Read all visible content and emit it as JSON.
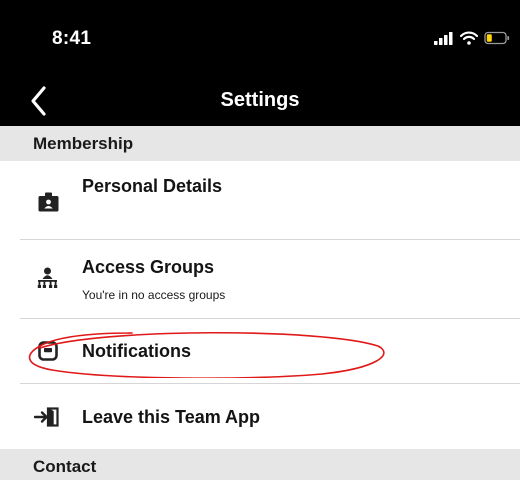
{
  "status_bar": {
    "time": "8:41",
    "icons": [
      "cellular-signal-icon",
      "wifi-icon",
      "battery-icon"
    ]
  },
  "header": {
    "title": "Settings",
    "back_icon": "chevron-left-icon"
  },
  "sections": {
    "membership": "Membership",
    "contact": "Contact"
  },
  "rows": {
    "personal_details": {
      "title": "Personal Details",
      "icon": "id-badge-icon"
    },
    "access_groups": {
      "title": "Access Groups",
      "subtitle": "You're in no access groups",
      "icon": "hierarchy-icon"
    },
    "notifications": {
      "title": "Notifications",
      "icon": "message-icon"
    },
    "leave": {
      "title": "Leave this Team App",
      "icon": "exit-door-icon"
    }
  },
  "colors": {
    "header_background": "#000000",
    "section_background": "#e6e6e6",
    "annotation": "#e01818",
    "battery_level": "#ffd60a"
  }
}
